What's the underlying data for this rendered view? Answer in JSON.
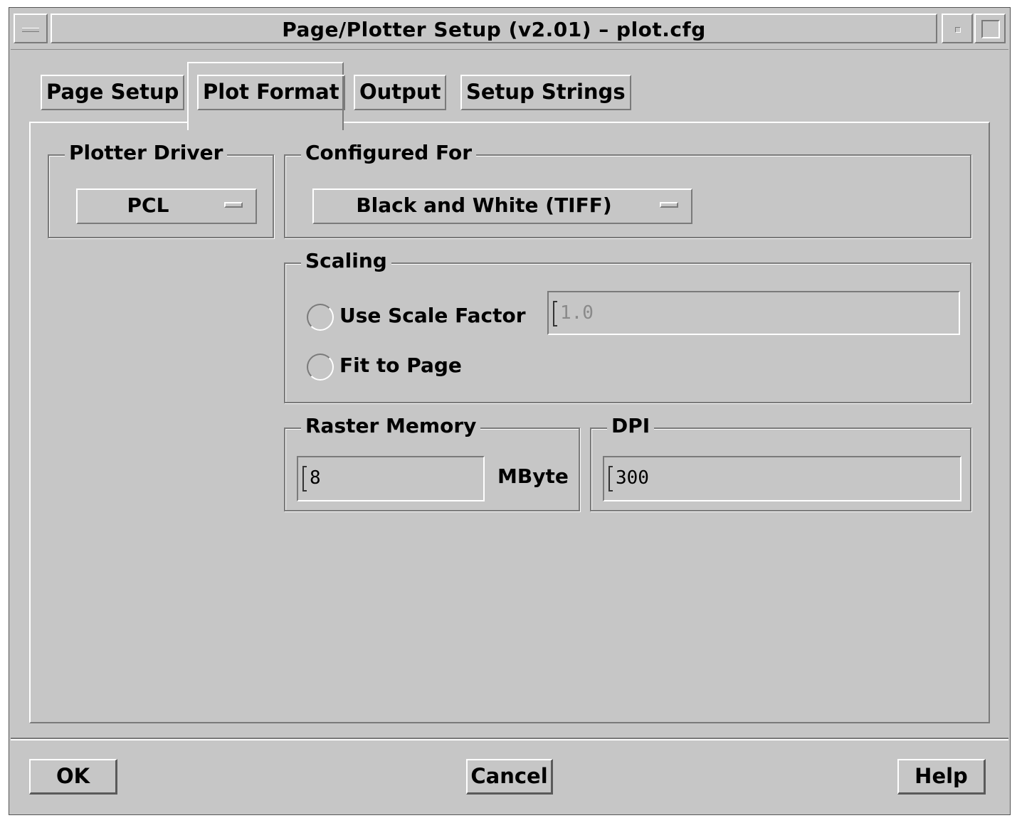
{
  "window": {
    "title": "Page/Plotter Setup  (v2.01) – plot.cfg"
  },
  "tabs": [
    {
      "label": "Page Setup",
      "active": false
    },
    {
      "label": "Plot Format",
      "active": true
    },
    {
      "label": "Output",
      "active": false
    },
    {
      "label": "Setup Strings",
      "active": false
    }
  ],
  "plotter_driver": {
    "legend": "Plotter Driver",
    "value": "PCL"
  },
  "configured_for": {
    "legend": "Configured For",
    "value": "Black and White (TIFF)"
  },
  "scaling": {
    "legend": "Scaling",
    "use_scale_factor_label": "Use Scale Factor",
    "scale_factor_value": "1.0",
    "fit_to_page_label": "Fit to Page"
  },
  "raster_memory": {
    "legend": "Raster Memory",
    "value": "8",
    "unit": "MByte"
  },
  "dpi": {
    "legend": "DPI",
    "value": "300"
  },
  "buttons": {
    "ok": "OK",
    "cancel": "Cancel",
    "help": "Help"
  }
}
